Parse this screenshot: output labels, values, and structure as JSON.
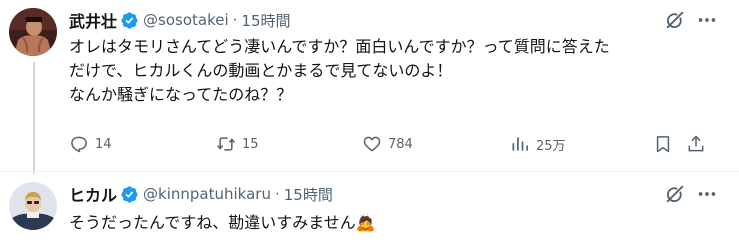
{
  "tweets": [
    {
      "author": {
        "name": "武井壮",
        "handle": "@sosotakei",
        "time": "15時間"
      },
      "text_lines": [
        "オレはタモリさんてどう凄いんですか？面白いんですか？って質問に答えた",
        "だけで、ヒカルくんの動画とかまるで見てないのよ！",
        "なんか騒ぎになってたのね？？"
      ],
      "actions": {
        "replies": "14",
        "retweets": "15",
        "likes": "784",
        "views": "25万"
      }
    },
    {
      "author": {
        "name": "ヒカル",
        "handle": "@kinnpatuhikaru",
        "time": "15時間"
      },
      "text": "そうだったんですね、勘違いすみません",
      "emoji": "🙇"
    }
  ],
  "separator": "·",
  "colors": {
    "verified": "#1d9bf0",
    "secondary_text": "#536471",
    "thread_line": "#cfd9de"
  },
  "icons": [
    "verified-badge-icon",
    "grok-icon",
    "more-icon",
    "reply-icon",
    "retweet-icon",
    "like-icon",
    "views-icon",
    "bookmark-icon",
    "share-icon"
  ]
}
